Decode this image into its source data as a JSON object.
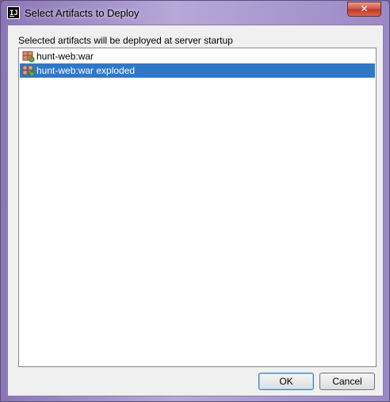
{
  "window": {
    "title": "Select Artifacts to Deploy",
    "app_icon_text": "IJ",
    "close_glyph": "✕"
  },
  "dialog": {
    "caption": "Selected artifacts will be deployed at server startup",
    "items": [
      {
        "label": "hunt-web:war",
        "icon": "war-artifact-icon",
        "selected": false
      },
      {
        "label": "hunt-web:war exploded",
        "icon": "war-exploded-artifact-icon",
        "selected": true
      }
    ],
    "ok_label": "OK",
    "cancel_label": "Cancel"
  },
  "colors": {
    "selection": "#3077c8",
    "titlebar": "#b7a8d8"
  }
}
